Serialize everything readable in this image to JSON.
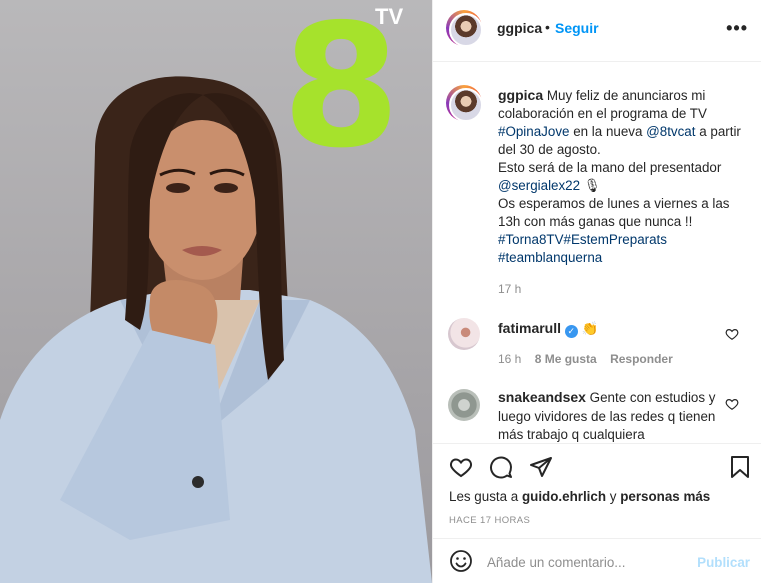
{
  "post": {
    "logo": {
      "digit": "8",
      "suffix": "TV",
      "color": "#a6e22c"
    }
  },
  "header": {
    "username": "ggpica",
    "separator": "•",
    "follow_label": "Seguir",
    "more_icon": "ellipsis-icon",
    "more_label": "•••"
  },
  "caption": {
    "username": "ggpica",
    "segments": [
      {
        "text": " Muy feliz de anunciaros mi colaboración en el programa de TV\n",
        "link": false
      },
      {
        "text": "#OpinaJove",
        "link": true
      },
      {
        "text": " en la nueva ",
        "link": false
      },
      {
        "text": "@8tvcat",
        "link": true
      },
      {
        "text": " a partir del 30 de agosto.\nEsto será de la mano del presentador\n",
        "link": false
      },
      {
        "text": "@sergialex22",
        "link": true
      },
      {
        "text": " 🎙\nOs esperamos de lunes a viernes a las 13h con más ganas que nunca !!\n",
        "link": false
      },
      {
        "text": "#Torna8TV",
        "link": true
      },
      {
        "text": "#EstemPreparats",
        "link": true
      },
      {
        "text": "\n",
        "link": false
      },
      {
        "text": "#teamblanquerna",
        "link": true
      }
    ],
    "time": "17 h"
  },
  "comments": [
    {
      "username": "fatimarull",
      "verified": true,
      "text": "👏",
      "time": "16 h",
      "likes": "8 Me gusta",
      "reply_label": "Responder"
    },
    {
      "username": "snakeandsex",
      "verified": false,
      "text": " Gente con estudios y luego vividores de las redes q tienen más trabajo q cualquiera"
    }
  ],
  "actions": {
    "icons": [
      "heart-icon",
      "comment-icon",
      "share-icon",
      "bookmark-icon"
    ],
    "likes_prefix": "Les gusta a ",
    "likes_user": "guido.ehrlich",
    "likes_middle": " y ",
    "likes_others": "personas más",
    "timestamp": "HACE 17 HORAS"
  },
  "add_comment": {
    "emoji_icon": "emoji-icon",
    "placeholder": "Añade un comentario...",
    "publish_label": "Publicar"
  },
  "colors": {
    "link": "#00376b",
    "follow": "#0095f6",
    "muted": "#8e8e8e",
    "publish_disabled": "#b2dffc"
  }
}
